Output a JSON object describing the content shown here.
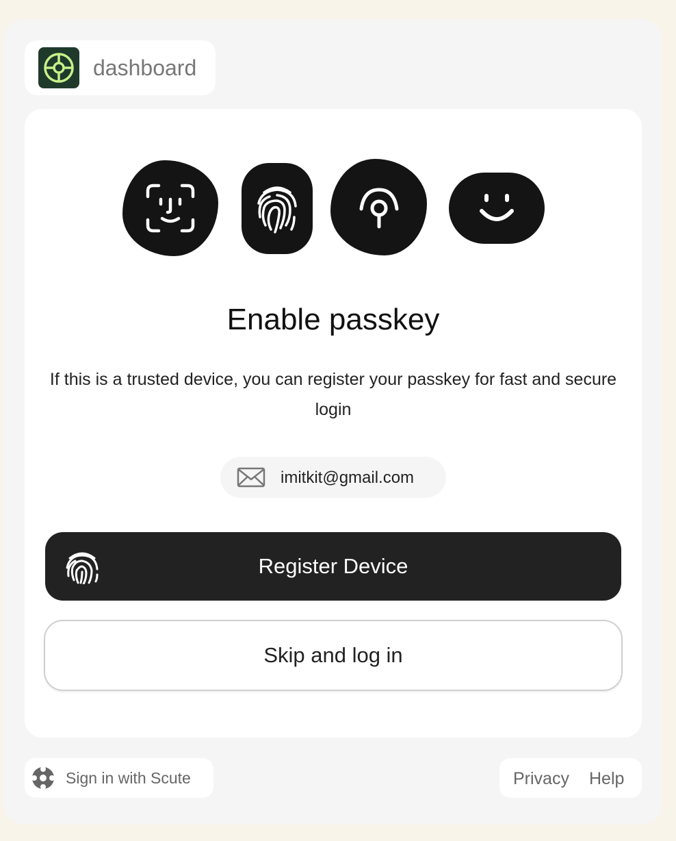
{
  "brand": {
    "name": "dashboard",
    "logo_icon": "orbit-logo-icon",
    "logo_bg": "#1f3a2b",
    "logo_accent": "#c8f08a"
  },
  "biometric_icons": [
    "face-id-icon",
    "fingerprint-icon",
    "passkey-icon",
    "smile-icon"
  ],
  "main": {
    "title": "Enable passkey",
    "subtitle": "If this is a trusted device, you can register your passkey for fast and secure login",
    "email": {
      "icon": "mail-icon",
      "value": "imitkit@gmail.com"
    },
    "register_button": {
      "label": "Register Device",
      "icon": "fingerprint-icon"
    },
    "skip_button": {
      "label": "Skip and log in"
    }
  },
  "footer": {
    "sign_in_label": "Sign in with Scute",
    "sign_in_icon": "scute-logo-icon",
    "links": {
      "privacy": "Privacy",
      "help": "Help"
    }
  },
  "colors": {
    "page_bg": "#f8f4e9",
    "panel_bg": "#f5f5f5",
    "primary_button": "#222222",
    "icon_fill": "#141414"
  }
}
